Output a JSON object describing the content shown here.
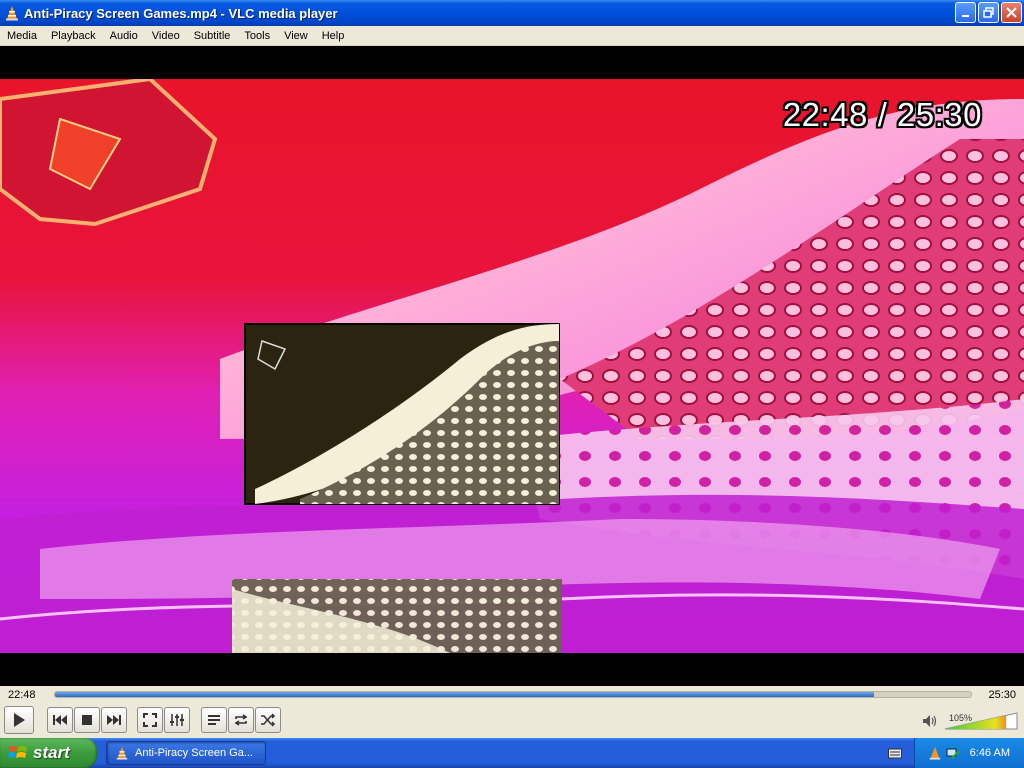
{
  "window": {
    "title": "Anti-Piracy Screen Games.mp4 - VLC media player"
  },
  "menu": [
    "Media",
    "Playback",
    "Audio",
    "Video",
    "Subtitle",
    "Tools",
    "View",
    "Help"
  ],
  "video": {
    "osd_time": "22:48 / 25:30"
  },
  "playback": {
    "elapsed": "22:48",
    "duration": "25:30",
    "progress_fraction": 0.894,
    "volume_label": "105%",
    "volume_fraction": 0.84
  },
  "taskbar": {
    "start_label": "start",
    "task_label": "Anti-Piracy Screen Ga...",
    "clock": "6:46 AM"
  },
  "icons": {
    "app": "vlc-cone-icon",
    "play": "play-icon",
    "prev": "previous-icon",
    "stop": "stop-icon",
    "next": "next-icon",
    "fullscreen": "fullscreen-icon",
    "extended": "extended-settings-icon",
    "playlist": "playlist-icon",
    "loop": "loop-icon",
    "random": "shuffle-icon",
    "volume": "speaker-icon"
  },
  "colors": {
    "titlebar": "#0050dc",
    "seek_fill": "#2a6cc8",
    "start_green": "#3c9a3c",
    "taskbar_blue": "#245edb"
  }
}
